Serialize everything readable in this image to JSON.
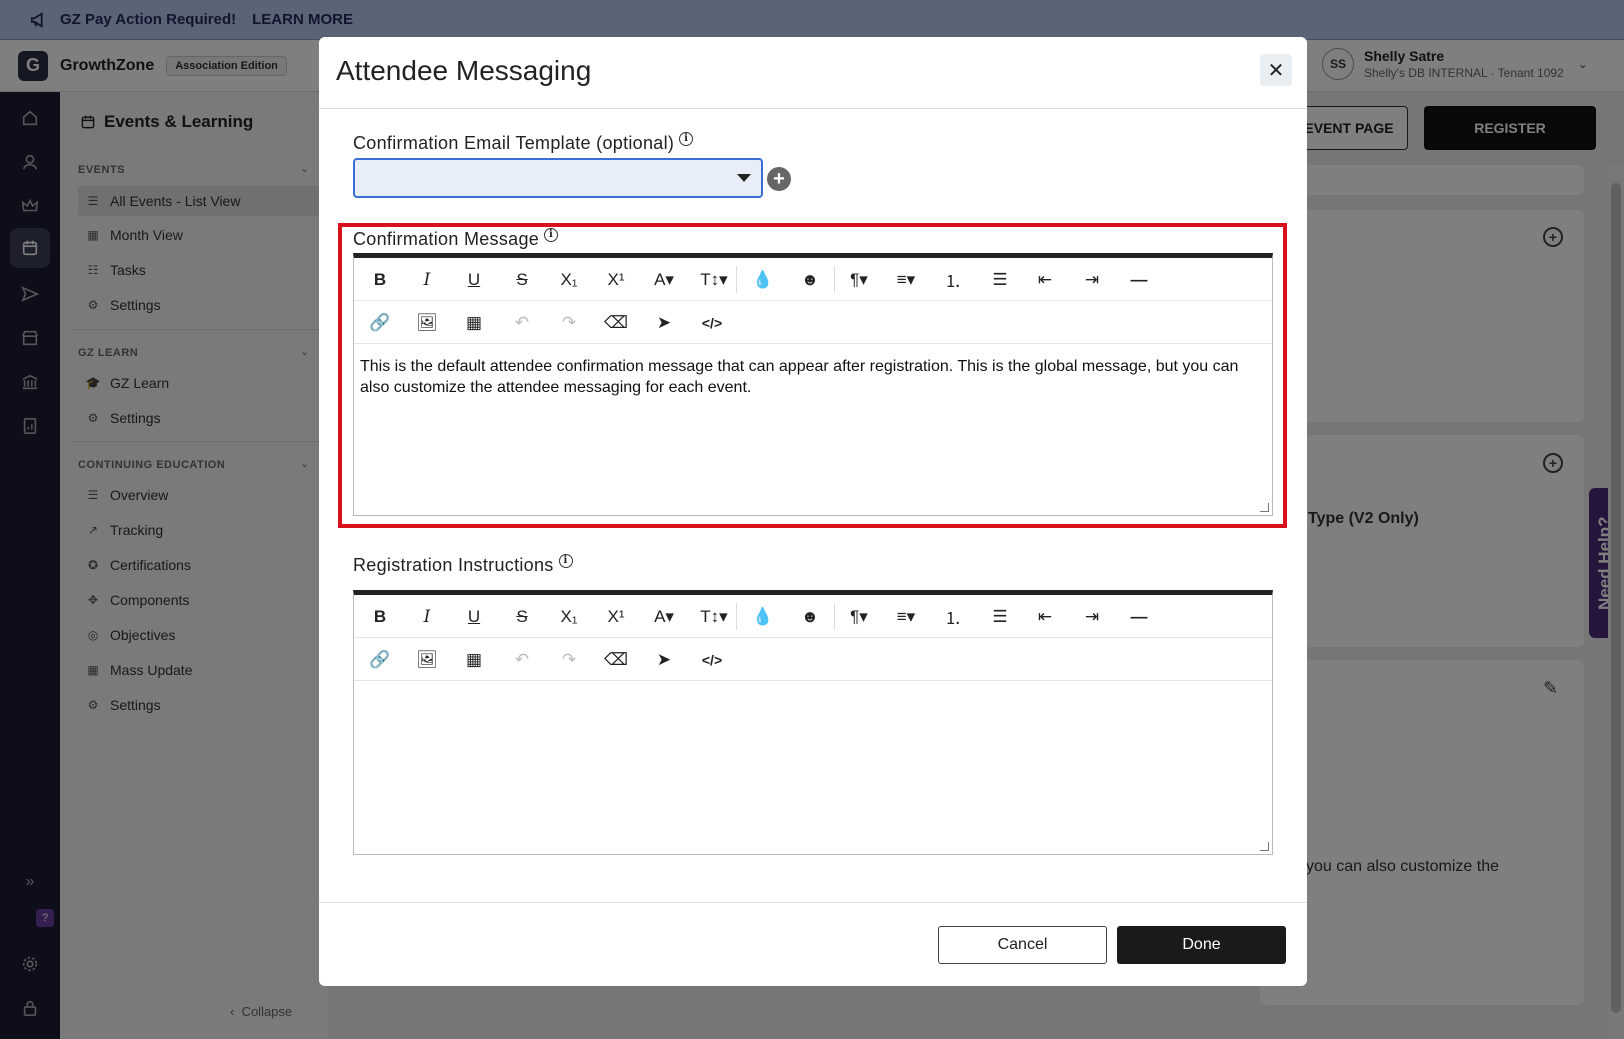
{
  "announcement": {
    "text": "GZ Pay Action Required!",
    "link": "LEARN MORE"
  },
  "header": {
    "logo": "G",
    "brand": "GrowthZone",
    "edition": "Association Edition",
    "user": {
      "initials": "SS",
      "name": "Shelly Satre",
      "tenant": "Shelly's DB INTERNAL · Tenant 1092"
    }
  },
  "rail_icons": [
    "home-icon",
    "person-icon",
    "crown-icon",
    "calendar-icon",
    "send-icon",
    "store-icon",
    "bank-icon",
    "report-icon",
    "expand-icon",
    "help-icon",
    "gear-icon",
    "lock-icon"
  ],
  "subnav": {
    "title": "Events & Learning",
    "sections": [
      {
        "label": "EVENTS",
        "items": [
          "All Events - List View",
          "Month View",
          "Tasks",
          "Settings"
        ]
      },
      {
        "label": "GZ LEARN",
        "items": [
          "GZ Learn",
          "Settings"
        ]
      },
      {
        "label": "CONTINUING EDUCATION",
        "items": [
          "Overview",
          "Tracking",
          "Certifications",
          "Components",
          "Objectives",
          "Mass Update",
          "Settings"
        ]
      }
    ],
    "collapse": "Collapse",
    "help_badge": "?"
  },
  "background": {
    "event_page_btn": "EVENT PAGE",
    "register_btn": "REGISTER",
    "type_label": "Type (V2 Only)",
    "partial_text": "you can also customize the",
    "need_help": "Need Help?"
  },
  "modal": {
    "title": "Attendee Messaging",
    "close": "✕",
    "template_label": "Confirmation Email Template (optional)",
    "template_value": "",
    "confirmation_label": "Confirmation Message",
    "confirmation_text": "This is the default attendee confirmation message that can appear after registration. This is the global message, but you can also customize the attendee messaging for each event.",
    "instructions_label": "Registration Instructions",
    "instructions_text": "",
    "toolbar_row1": [
      "B",
      "I",
      "U",
      "S",
      "X₁",
      "X¹",
      "A▾",
      "T↕▾",
      "drop-icon",
      "smile-icon",
      "¶▾",
      "≡▾",
      "ordered-list-icon",
      "bullet-list-icon",
      "outdent-icon",
      "indent-icon",
      "horizontal-rule-icon"
    ],
    "toolbar_row2": [
      "link-icon",
      "image-icon",
      "table-icon",
      "undo-icon",
      "redo-icon",
      "eraser-icon",
      "select-icon",
      "code-view-icon"
    ],
    "cancel": "Cancel",
    "done": "Done"
  }
}
